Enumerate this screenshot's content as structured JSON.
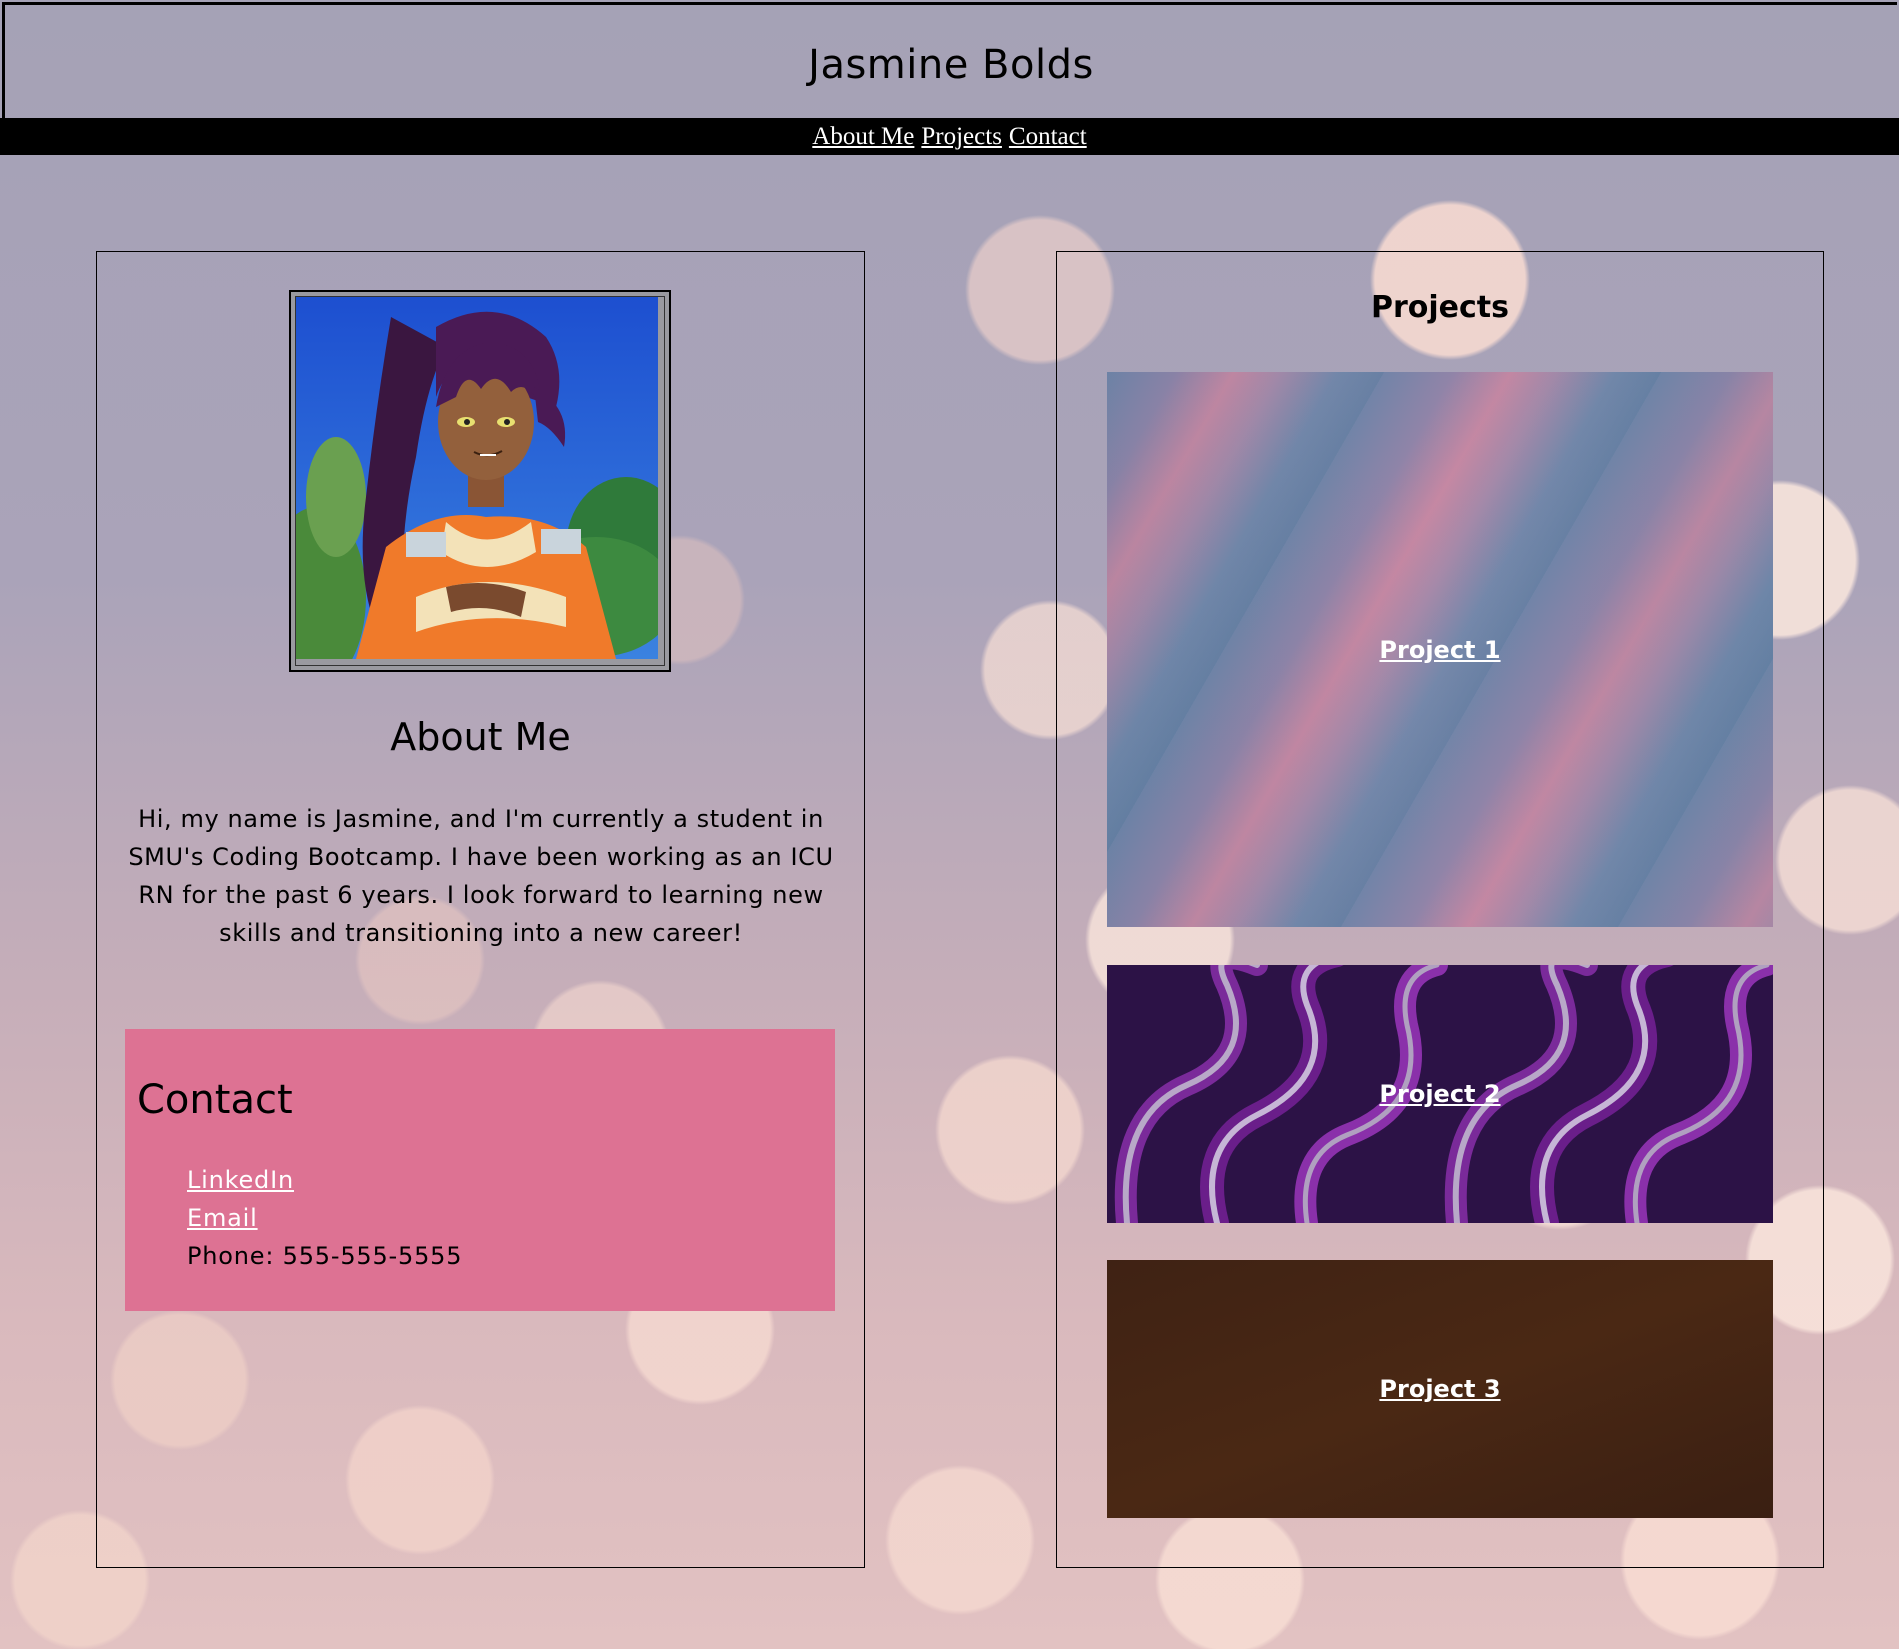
{
  "header": {
    "title": "Jasmine Bolds"
  },
  "nav": {
    "items": [
      {
        "label": "About Me"
      },
      {
        "label": "Projects"
      },
      {
        "label": "Contact"
      }
    ]
  },
  "about": {
    "avatar_icon": "profile-photo",
    "title": "About Me",
    "text": "Hi, my name is Jasmine, and I'm currently a student in SMU's Coding Bootcamp. I have been working as an ICU RN for the past 6 years. I look forward to learning new skills and transitioning into a new career!"
  },
  "contact": {
    "title": "Contact",
    "linkedin_label": "LinkedIn",
    "email_label": "Email",
    "phone_text": "Phone: 555-555-5555",
    "background_color": "#dd7293"
  },
  "projects": {
    "title": "Projects",
    "items": [
      {
        "label": "Project 1"
      },
      {
        "label": "Project 2"
      },
      {
        "label": "Project 3"
      }
    ]
  }
}
